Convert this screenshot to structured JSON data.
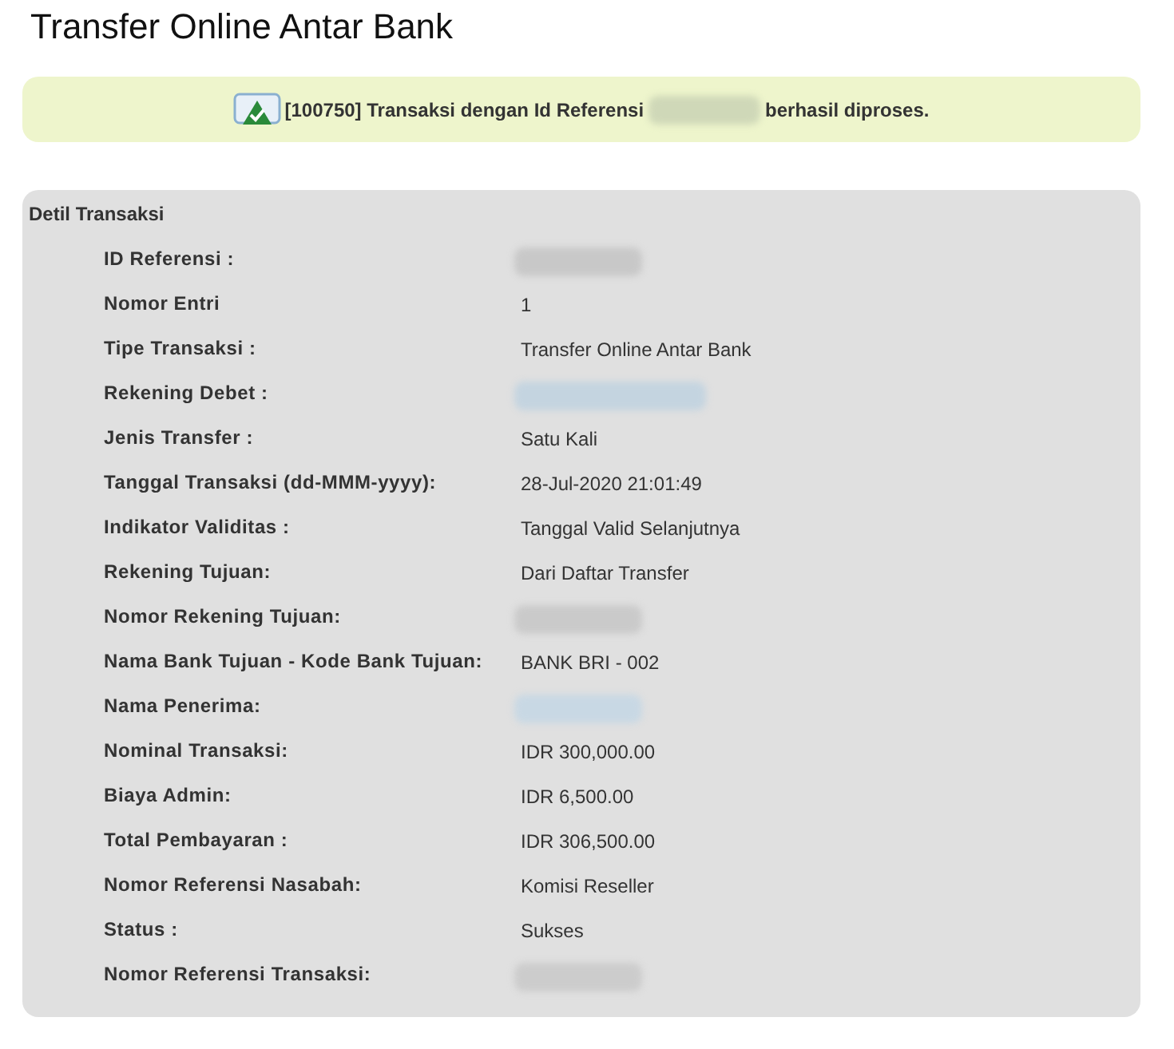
{
  "title": "Transfer Online Antar Bank",
  "notice": {
    "before": "[100750] Transaksi dengan Id Referensi",
    "after": "berhasil diproses."
  },
  "section": {
    "title": "Detil Transaksi",
    "rows": [
      {
        "label": "ID Referensi :",
        "kind": "redacted",
        "color": "#c8c8c8"
      },
      {
        "label": "Nomor Entri",
        "kind": "text",
        "value": "1"
      },
      {
        "label": "Tipe Transaksi :",
        "kind": "text",
        "value": "Transfer Online Antar Bank"
      },
      {
        "label": "Rekening Debet :",
        "kind": "redacted",
        "color": "#c4d4e0"
      },
      {
        "label": "Jenis Transfer :",
        "kind": "text",
        "value": "Satu Kali"
      },
      {
        "label": "Tanggal Transaksi (dd-MMM-yyyy):",
        "kind": "text",
        "value": "28-Jul-2020 21:01:49"
      },
      {
        "label": "Indikator Validitas :",
        "kind": "text",
        "value": "Tanggal Valid Selanjutnya"
      },
      {
        "label": "Rekening Tujuan:",
        "kind": "text",
        "value": "Dari Daftar Transfer"
      },
      {
        "label": "Nomor Rekening Tujuan:",
        "kind": "redacted",
        "color": "#cacaca"
      },
      {
        "label": "Nama Bank Tujuan - Kode Bank Tujuan:",
        "kind": "text",
        "value": "BANK BRI - 002"
      },
      {
        "label": "Nama Penerima:",
        "kind": "redacted",
        "color": "#c8d8e4"
      },
      {
        "label": "Nominal Transaksi:",
        "kind": "text",
        "value": "IDR 300,000.00"
      },
      {
        "label": "Biaya Admin:",
        "kind": "text",
        "value": "IDR 6,500.00"
      },
      {
        "label": "Total Pembayaran :",
        "kind": "text",
        "value": "IDR 306,500.00"
      },
      {
        "label": "Nomor Referensi Nasabah:",
        "kind": "text",
        "value": "Komisi Reseller"
      },
      {
        "label": "Status :",
        "kind": "text",
        "value": "Sukses"
      },
      {
        "label": "Nomor Referensi Transaksi:",
        "kind": "redacted",
        "color": "#cccccc"
      }
    ]
  }
}
